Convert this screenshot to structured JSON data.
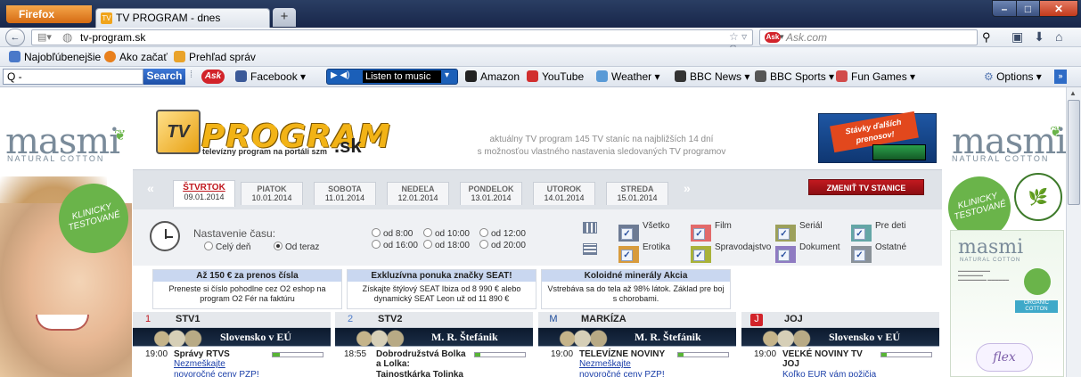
{
  "browser": {
    "menu_button": "Firefox",
    "tab_title": "TV PROGRAM - dnes",
    "tab_favicon": "TV",
    "new_tab": "+",
    "url": "tv-program.sk",
    "search_placeholder": "Ask.com",
    "ask_logo": "Ask"
  },
  "bookmarks": [
    {
      "label": "Najobľúbenejšie",
      "color": "#4a79c9"
    },
    {
      "label": "Ako začať",
      "color": "#e8801d"
    },
    {
      "label": "Prehľad správ",
      "color": "#e9a32a"
    }
  ],
  "ask_toolbar": {
    "combo_value": "Q -",
    "search_button": "Search",
    "ask_logo": "Ask",
    "items": [
      {
        "label": "Facebook",
        "color": "#3b5998"
      },
      {
        "label": "Amazon",
        "color": "#222222"
      },
      {
        "label": "YouTube",
        "color": "#d12f2f"
      },
      {
        "label": "Weather",
        "color": "#5a9ad6"
      },
      {
        "label": "BBC News",
        "color": "#333333"
      },
      {
        "label": "BBC Sports",
        "color": "#555555"
      },
      {
        "label": "Fun Games",
        "color": "#d14b4b"
      }
    ],
    "music_label": "Listen to music",
    "options": "Options"
  },
  "ads": {
    "left_brand": "masmi",
    "left_sub": "NATURAL COTTON",
    "left_badge": "KLINICKY TESTOVANÉ",
    "right_brand": "masmi",
    "right_sub": "NATURAL COTTON",
    "right_badge": "KLINICKY TESTOVANÉ",
    "product_brand": "masmi",
    "product_sub": "NATURAL COTTON",
    "product_badge": "ORGANIC COTTON",
    "product_flex": "flex"
  },
  "header": {
    "logo_tv": "TV",
    "logo_text": "PROGRAM",
    "logo_sk": ".sk",
    "logo_sub": "televízny program na portáli szm",
    "tagline_1": "aktuálny TV program 145 TV staníc na najbližších 14 dní",
    "tagline_2": "s možnosťou vlastného nastavenia sledovaných TV programov",
    "stavky": "Stávky ďalších prenosov!"
  },
  "days": {
    "prev": "«",
    "next": "»",
    "items": [
      {
        "name": "ŠTVRTOK",
        "date": "09.01.2014",
        "active": true
      },
      {
        "name": "PIATOK",
        "date": "10.01.2014"
      },
      {
        "name": "SOBOTA",
        "date": "11.01.2014"
      },
      {
        "name": "NEDEĽA",
        "date": "12.01.2014"
      },
      {
        "name": "PONDELOK",
        "date": "13.01.2014"
      },
      {
        "name": "UTOROK",
        "date": "14.01.2014"
      },
      {
        "name": "STREDA",
        "date": "15.01.2014"
      }
    ],
    "change_button": "ZMENIŤ TV STANICE"
  },
  "settings": {
    "label": "Nastavenie času:",
    "celyden": "Celý deň",
    "odteraz": "Od teraz",
    "times": [
      "od 8:00",
      "od 10:00",
      "od 12:00",
      "od 16:00",
      "od 18:00",
      "od 20:00"
    ],
    "categories": [
      {
        "label": "Všetko",
        "color": "#6d7b94"
      },
      {
        "label": "Film",
        "color": "#e26a6a"
      },
      {
        "label": "Seriál",
        "color": "#9ca05b"
      },
      {
        "label": "Pre deti",
        "color": "#64a6a6"
      },
      {
        "label": "Erotika",
        "color": "#d89b3c"
      },
      {
        "label": "Spravodajstvo",
        "color": "#a9b23a"
      },
      {
        "label": "Dokument",
        "color": "#8f7bc2"
      },
      {
        "label": "Ostatné",
        "color": "#8a9299"
      }
    ]
  },
  "promos": [
    {
      "title": "Až 150 € za prenos čísla",
      "body": "Preneste si číslo pohodlne cez O2 eshop na program O2 Fér na faktúru"
    },
    {
      "title": "Exkluzívna ponuka značky SEAT!",
      "body": "Získajte štýlový SEAT Ibiza od 8 990 € alebo dynamický SEAT Leon už od 11 890 €"
    },
    {
      "title": "Koloidné minerály Akcia",
      "body": "Vstrebáva sa do tela až 98% látok. Základ pre boj s chorobami."
    }
  ],
  "channels": [
    {
      "name": "STV1",
      "logo": "1",
      "banner": "Slovensko v EÚ",
      "time": "19:00",
      "title": "Správy RTVS",
      "progress": 0.15,
      "link": "Nezmeškajte",
      "sub": "",
      "link2": "novoročné ceny PZP!"
    },
    {
      "name": "STV2",
      "logo": "2",
      "banner": "M. R. Štefánik",
      "time": "18:55",
      "title": "Dobrodružstvá Bolka",
      "progress": 0.1,
      "link": "",
      "sub": "a Lolka:",
      "link2": "Tajnostkárka Tolinka"
    },
    {
      "name": "MARKÍZA",
      "logo": "M",
      "banner": "M. R. Štefánik",
      "time": "19:00",
      "title": "TELEVÍZNE NOVINY",
      "progress": 0.1,
      "link": "Nezmeškajte",
      "sub": "",
      "link2": "novoročné ceny PZP!"
    },
    {
      "name": "JOJ",
      "logo": "J",
      "banner": "Slovensko v EÚ",
      "time": "19:00",
      "title": "VEĽKÉ NOVINY TV",
      "progress": 0.1,
      "link": "",
      "sub": "JOJ",
      "link2": "Koľko EUR vám požičia"
    }
  ]
}
